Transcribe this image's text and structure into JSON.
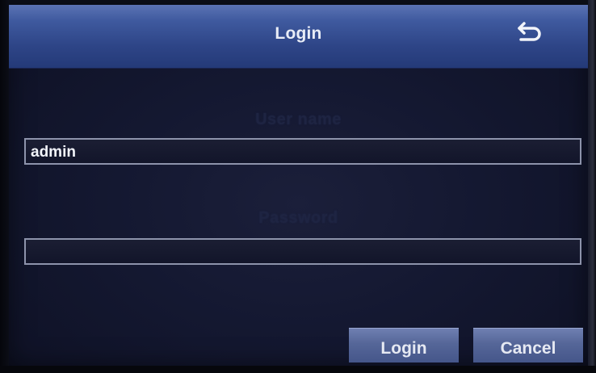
{
  "dialog": {
    "title": "Login",
    "back_icon": "return-arrow-icon"
  },
  "form": {
    "username": {
      "label": "User name",
      "value": "admin"
    },
    "password": {
      "label": "Password",
      "value": ""
    }
  },
  "buttons": {
    "login_label": "Login",
    "cancel_label": "Cancel"
  },
  "colors": {
    "title_bar": "#2e4587",
    "background": "#141831",
    "button": "#556698",
    "input_border": "#8d93ab",
    "label_text": "#1e2442"
  }
}
